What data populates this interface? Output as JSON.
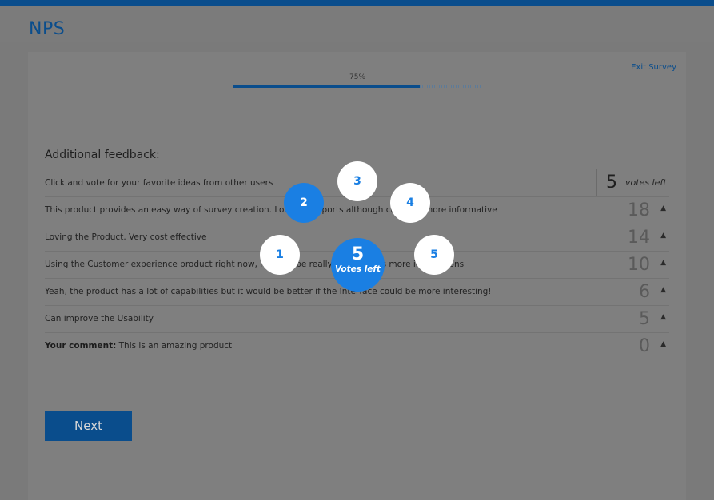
{
  "app": {
    "title": "NPS"
  },
  "survey": {
    "exit_label": "Exit Survey",
    "progress_text": "75%",
    "progress_fraction": 0.75
  },
  "feedback": {
    "title": "Additional feedback:",
    "instruction": "Click and vote for your favorite ideas from other users",
    "votes_left_count": "5",
    "votes_left_label": "votes left",
    "ideas": [
      {
        "text": "This product provides an easy way of survey creation. Love the reports although could be more informative",
        "votes": "18"
      },
      {
        "text": "Loving the Product. Very cost effective",
        "votes": "14"
      },
      {
        "text": "Using the Customer experience product right now, it would be really nice if it has more integrations",
        "votes": "10"
      },
      {
        "text": "Yeah, the product has a lot of capabilities but it would be better if the Interface could be more interesting!",
        "votes": "6"
      },
      {
        "text": "Can improve the Usability",
        "votes": "5"
      }
    ],
    "your_comment_label": "Your comment:",
    "your_comment_text": "This is an amazing product",
    "your_comment_votes": "0",
    "upvote_symbol": "▲"
  },
  "vote_picker": {
    "options": [
      "1",
      "2",
      "3",
      "4",
      "5"
    ],
    "selected": "2",
    "center_count": "5",
    "center_label": "Votes left"
  },
  "actions": {
    "next_label": "Next"
  },
  "colors": {
    "brand": "#0a4d8c",
    "accent": "#1a7fe3"
  }
}
